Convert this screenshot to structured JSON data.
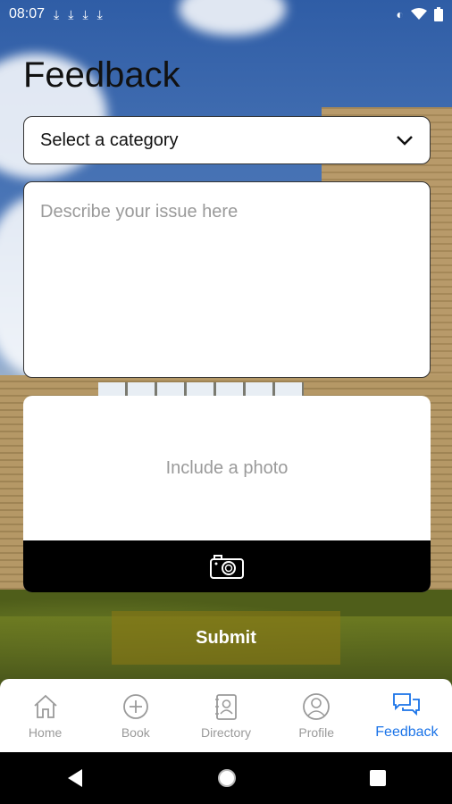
{
  "status_bar": {
    "time": "08:07",
    "download_icons": [
      "download-done-icon",
      "download-done-icon",
      "download-done-icon",
      "download-done-icon"
    ],
    "right_icons": [
      "data-saver-icon",
      "wifi-icon",
      "battery-icon"
    ]
  },
  "page": {
    "title": "Feedback"
  },
  "form": {
    "category_select": {
      "value": "Select a category",
      "icon": "chevron-down-icon"
    },
    "issue_field": {
      "placeholder": "Describe your issue here"
    },
    "photo": {
      "hint": "Include a photo",
      "icon": "camera-icon"
    },
    "submit_label": "Submit"
  },
  "tab_bar": {
    "items": [
      {
        "label": "Home",
        "icon": "home-icon",
        "active": false
      },
      {
        "label": "Book",
        "icon": "add-circle-icon",
        "active": false
      },
      {
        "label": "Directory",
        "icon": "contacts-book-icon",
        "active": false
      },
      {
        "label": "Profile",
        "icon": "user-circle-icon",
        "active": false
      },
      {
        "label": "Feedback",
        "icon": "chat-bubbles-icon",
        "active": true
      }
    ],
    "active_color": "#1a73e8",
    "inactive_color": "#9a9a9a"
  },
  "nav_bar": {
    "buttons": [
      "back-icon",
      "home-circle-icon",
      "recents-icon"
    ]
  }
}
